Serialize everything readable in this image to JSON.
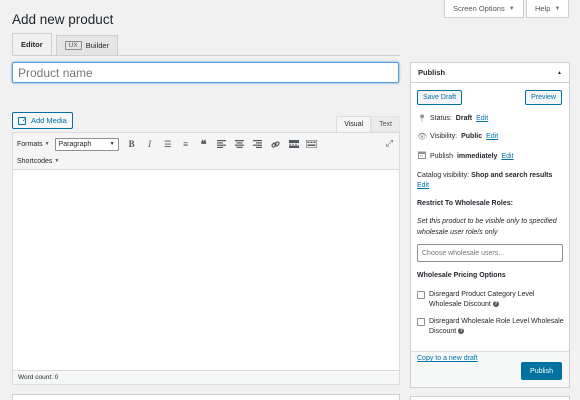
{
  "header": {
    "screen_options": "Screen Options",
    "help": "Help",
    "page_title": "Add new product"
  },
  "editor_tabs": [
    {
      "label": "Editor"
    },
    {
      "badge": "UX",
      "label": "Builder"
    }
  ],
  "title_field": {
    "placeholder": "Product name",
    "value": ""
  },
  "add_media": "Add Media",
  "mode_tabs": {
    "visual": "Visual",
    "text": "Text"
  },
  "toolbar": {
    "formats": "Formats",
    "paragraph": "Paragraph",
    "shortcodes": "Shortcodes"
  },
  "word_count": "Word count: 0",
  "publish": {
    "title": "Publish",
    "save_draft": "Save Draft",
    "preview": "Preview",
    "status_label": "Status:",
    "status_value": "Draft",
    "visibility_label": "Visibility:",
    "visibility_value": "Public",
    "publish_label": "Publish",
    "publish_value": "immediately",
    "edit": "Edit",
    "catalog_label": "Catalog visibility:",
    "catalog_value": "Shop and search results",
    "restrict_title": "Restrict To Wholesale Roles:",
    "restrict_desc": "Set this product to be visible only to specified wholesale user role/s only",
    "wholesale_placeholder": "Choose wholesale users...",
    "pricing_title": "Wholesale Pricing Options",
    "option1": "Disregard Product Category Level Wholesale Discount",
    "option2": "Disregard Wholesale Role Level Wholesale Discount",
    "copy_draft": "Copy to a new draft",
    "publish_button": "Publish"
  }
}
